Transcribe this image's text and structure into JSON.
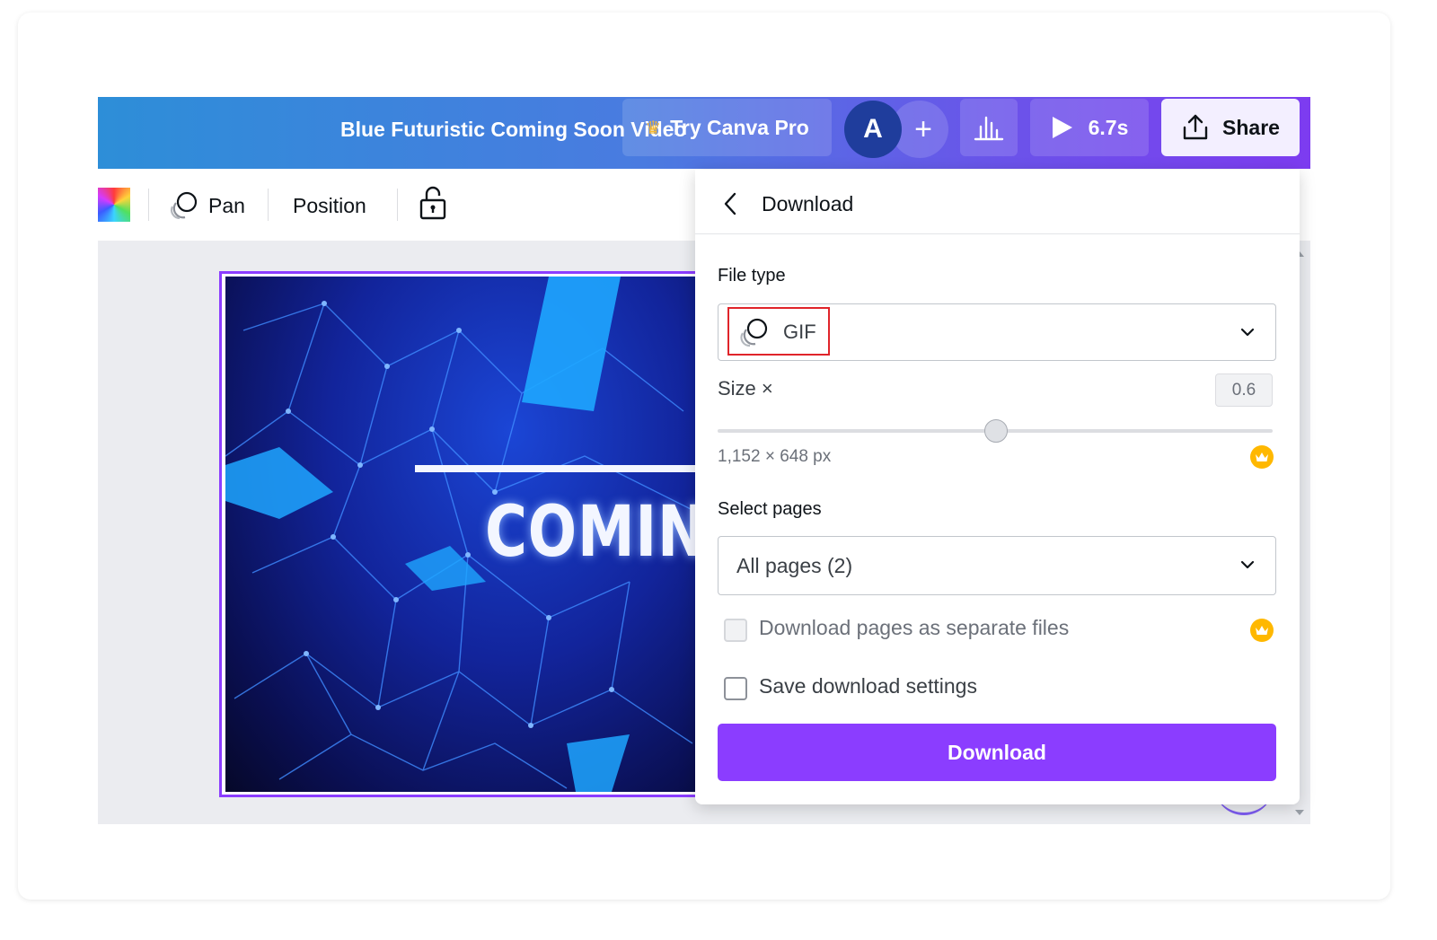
{
  "topbar": {
    "title": "Blue Futuristic Coming Soon Video",
    "pro_label": "Try Canva Pro",
    "avatar_initial": "A",
    "add_label": "+",
    "duration": "6.7s",
    "share_label": "Share"
  },
  "toolbar": {
    "pan_label": "Pan",
    "position_label": "Position"
  },
  "canvas": {
    "headline": "COMING"
  },
  "panel": {
    "title": "Download",
    "file_type_label": "File type",
    "file_type_value": "GIF",
    "size_label": "Size ×",
    "size_value": "0.6",
    "dimensions": "1,152 × 648 px",
    "select_pages_label": "Select pages",
    "pages_value": "All pages (2)",
    "separate_files_label": "Download pages as separate files",
    "save_settings_label": "Save download settings",
    "download_label": "Download"
  },
  "colors": {
    "accent": "#8b3dff",
    "crown": "#ffb800",
    "highlight_box": "#e0242a"
  },
  "icons": [
    "crown-icon",
    "bar-chart-icon",
    "play-icon",
    "share-upload-icon",
    "color-swatch-icon",
    "pan-icon",
    "lock-icon",
    "back-arrow-icon",
    "gif-icon",
    "chevron-down-icon",
    "crown-badge-icon"
  ]
}
